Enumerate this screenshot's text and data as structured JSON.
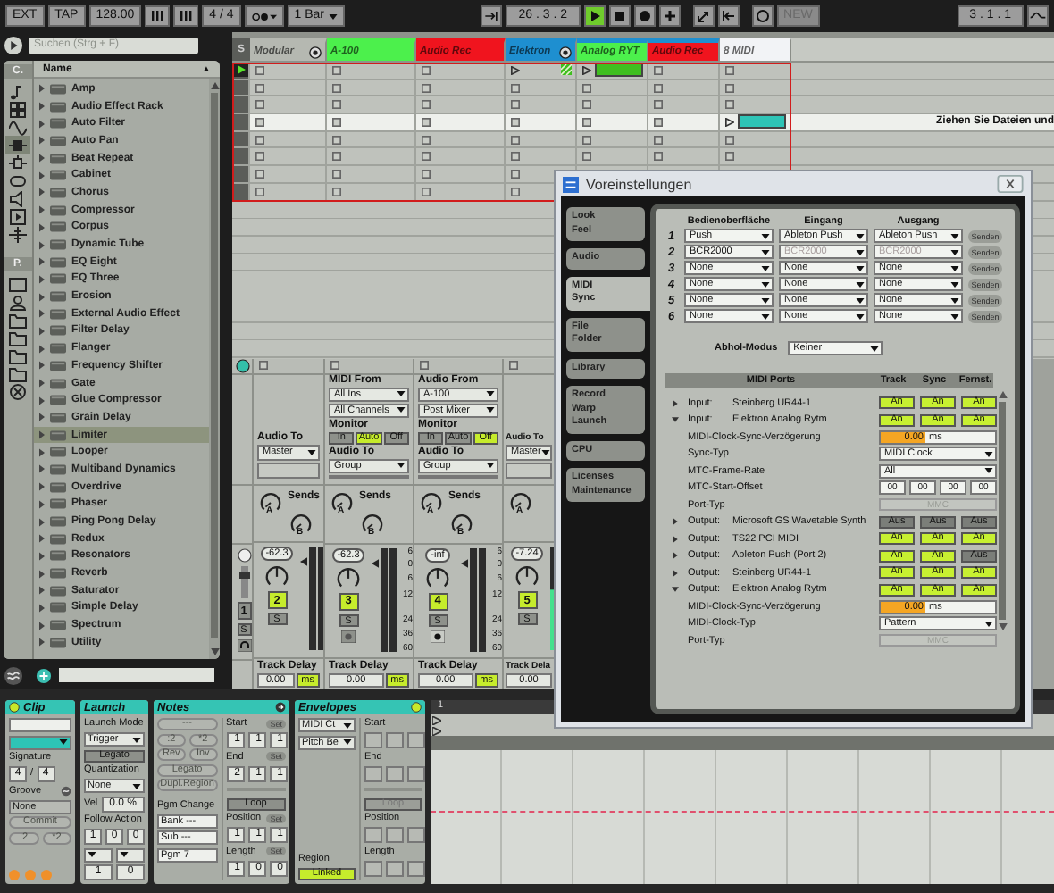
{
  "transport": {
    "left": [
      {
        "kind": "button",
        "text": "EXT"
      },
      {
        "kind": "button",
        "text": "TAP"
      },
      {
        "kind": "field",
        "text": "128.00"
      },
      {
        "kind": "nudge"
      },
      {
        "kind": "nudge"
      },
      {
        "kind": "field",
        "text": "4 / 4"
      },
      {
        "kind": "metronome"
      },
      {
        "kind": "dropdown",
        "text": "1 Bar"
      }
    ],
    "position": "26 . 3 . 2",
    "playing": true,
    "new_button": "NEW",
    "loop_position": "3 . 1 . 1"
  },
  "browser": {
    "search_placeholder": "Suchen (Strg + F)",
    "categories_label": "C.",
    "places_label": "P.",
    "column": "Name",
    "sort_mark": "▲",
    "categories": [
      {
        "selected": false
      },
      {
        "selected": false
      },
      {
        "selected": false
      },
      {
        "selected": true
      },
      {
        "selected": false
      },
      {
        "selected": false
      },
      {
        "selected": false
      },
      {
        "selected": false
      },
      {
        "selected": false
      }
    ],
    "items": [
      {
        "name": "Amp",
        "selected": false
      },
      {
        "name": "Audio Effect Rack",
        "selected": false
      },
      {
        "name": "Auto Filter",
        "selected": false
      },
      {
        "name": "Auto Pan",
        "selected": false
      },
      {
        "name": "Beat Repeat",
        "selected": false
      },
      {
        "name": "Cabinet",
        "selected": false
      },
      {
        "name": "Chorus",
        "selected": false
      },
      {
        "name": "Compressor",
        "selected": false
      },
      {
        "name": "Corpus",
        "selected": false
      },
      {
        "name": "Dynamic Tube",
        "selected": false
      },
      {
        "name": "EQ Eight",
        "selected": false
      },
      {
        "name": "EQ Three",
        "selected": false
      },
      {
        "name": "Erosion",
        "selected": false
      },
      {
        "name": "External Audio Effect",
        "selected": false
      },
      {
        "name": "Filter Delay",
        "selected": false
      },
      {
        "name": "Flanger",
        "selected": false
      },
      {
        "name": "Frequency Shifter",
        "selected": false
      },
      {
        "name": "Gate",
        "selected": false
      },
      {
        "name": "Glue Compressor",
        "selected": false
      },
      {
        "name": "Grain Delay",
        "selected": false
      },
      {
        "name": "Limiter",
        "selected": true
      },
      {
        "name": "Looper",
        "selected": false
      },
      {
        "name": "Multiband Dynamics",
        "selected": false
      },
      {
        "name": "Overdrive",
        "selected": false
      },
      {
        "name": "Phaser",
        "selected": false
      },
      {
        "name": "Ping Pong Delay",
        "selected": false
      },
      {
        "name": "Redux",
        "selected": false
      },
      {
        "name": "Resonators",
        "selected": false
      },
      {
        "name": "Reverb",
        "selected": false
      },
      {
        "name": "Saturator",
        "selected": false
      },
      {
        "name": "Simple Delay",
        "selected": false
      },
      {
        "name": "Spectrum",
        "selected": false
      },
      {
        "name": "Utility",
        "selected": false
      }
    ]
  },
  "session": {
    "solo_label": "S",
    "tracks": [
      {
        "name": "Modular",
        "color": "#b5b8b1",
        "group": true,
        "in_group": false
      },
      {
        "name": "A-100",
        "color": "#4cf04c",
        "group": false,
        "in_group": false
      },
      {
        "name": "Audio Rec",
        "color": "#f0141e",
        "group": false,
        "in_group": false
      },
      {
        "name": "Elektron",
        "color": "#1e8fd0",
        "group": true,
        "in_group": false
      },
      {
        "name": "Analog RYT",
        "color": "#4cf04c",
        "group": false,
        "in_group": true
      },
      {
        "name": "Audio Rec",
        "color": "#f0141e",
        "group": false,
        "in_group": true
      },
      {
        "name": "8 MIDI",
        "color": "#f2f3f6",
        "group": false,
        "in_group": false
      }
    ],
    "rows": [
      {
        "scene_play": true,
        "selected": false,
        "slots": [
          {
            "kind": "empty"
          },
          {
            "kind": "empty"
          },
          {
            "kind": "empty"
          },
          {
            "kind": "group-play",
            "color": "#3fbf1f"
          },
          {
            "kind": "clip",
            "color": "#3fbf1f"
          },
          {
            "kind": "empty"
          },
          {
            "kind": "empty"
          }
        ]
      },
      {
        "scene_play": false,
        "selected": false,
        "slots": [
          {
            "kind": "empty"
          },
          {
            "kind": "empty"
          },
          {
            "kind": "empty"
          },
          {
            "kind": "empty"
          },
          {
            "kind": "empty"
          },
          {
            "kind": "empty"
          },
          {
            "kind": "empty"
          }
        ]
      },
      {
        "scene_play": false,
        "selected": false,
        "slots": [
          {
            "kind": "empty"
          },
          {
            "kind": "empty"
          },
          {
            "kind": "empty"
          },
          {
            "kind": "empty"
          },
          {
            "kind": "empty"
          },
          {
            "kind": "empty"
          },
          {
            "kind": "empty"
          }
        ]
      },
      {
        "scene_play": false,
        "selected": true,
        "slots": [
          {
            "kind": "empty"
          },
          {
            "kind": "empty"
          },
          {
            "kind": "empty"
          },
          {
            "kind": "empty"
          },
          {
            "kind": "empty"
          },
          {
            "kind": "empty"
          },
          {
            "kind": "clip",
            "color": "#2ec4b6"
          }
        ],
        "hint": "Ziehen Sie Dateien und"
      },
      {
        "scene_play": false,
        "selected": false,
        "slots": [
          {
            "kind": "empty"
          },
          {
            "kind": "empty"
          },
          {
            "kind": "empty"
          },
          {
            "kind": "empty"
          },
          {
            "kind": "empty"
          },
          {
            "kind": "empty"
          },
          {
            "kind": "empty"
          }
        ]
      },
      {
        "scene_play": false,
        "selected": false,
        "slots": [
          {
            "kind": "empty"
          },
          {
            "kind": "empty"
          },
          {
            "kind": "empty"
          },
          {
            "kind": "empty"
          },
          {
            "kind": "empty"
          },
          {
            "kind": "empty"
          },
          {
            "kind": "empty"
          }
        ]
      },
      {
        "scene_play": false,
        "selected": false,
        "slots": [
          {
            "kind": "empty"
          },
          {
            "kind": "empty"
          },
          {
            "kind": "empty"
          },
          {
            "kind": "empty"
          }
        ]
      },
      {
        "scene_play": false,
        "selected": false,
        "slots": [
          {
            "kind": "empty"
          },
          {
            "kind": "empty"
          },
          {
            "kind": "empty"
          },
          {
            "kind": "empty"
          }
        ]
      }
    ]
  },
  "mixer": {
    "columns": [
      {
        "kind": "narrow",
        "number": "1",
        "solo": "S",
        "slider": {
          "level": 0.8
        }
      },
      {
        "kind": "track",
        "audio_to_label": "Audio To",
        "audio_to": "Master",
        "sends_label": "Sends",
        "sends": [
          "A",
          "B"
        ],
        "volume": "-62.3",
        "number": "2",
        "solo": "S",
        "delay_label": "Track Delay",
        "delay": "0.00",
        "delay_unit": "ms"
      },
      {
        "kind": "track",
        "from_label": "MIDI From",
        "from": "All Ins",
        "channel": "All Channels",
        "monitor_label": "Monitor",
        "monitor": [
          {
            "text": "In",
            "selected": false
          },
          {
            "text": "Auto",
            "selected": true
          },
          {
            "text": "Off",
            "selected": false
          }
        ],
        "audio_to_label": "Audio To",
        "audio_to": "Group",
        "sends_label": "Sends",
        "sends": [
          "A",
          "B"
        ],
        "volume": "-62.3",
        "number": "3",
        "solo": "S",
        "arm": false,
        "meter_scale": [
          "6",
          "0",
          "6",
          "12",
          "24",
          "36",
          "60"
        ],
        "delay_label": "Track Delay",
        "delay": "0.00",
        "delay_unit": "ms"
      },
      {
        "kind": "track",
        "from_label": "Audio From",
        "from": "A-100",
        "channel": "Post Mixer",
        "monitor_label": "Monitor",
        "monitor": [
          {
            "text": "In",
            "selected": false
          },
          {
            "text": "Auto",
            "selected": false
          },
          {
            "text": "Off",
            "selected": true
          }
        ],
        "audio_to_label": "Audio To",
        "audio_to": "Group",
        "sends_label": "Sends",
        "sends": [
          "A",
          "B"
        ],
        "volume": "-inf",
        "number": "4",
        "solo": "S",
        "arm": true,
        "meter_scale": [
          "6",
          "0",
          "6",
          "12",
          "24",
          "36",
          "60"
        ],
        "delay_label": "Track Delay",
        "delay": "0.00",
        "delay_unit": "ms"
      },
      {
        "kind": "partial",
        "audio_to_label": "Audio To",
        "audio_to": "Master",
        "sends": [
          "A"
        ],
        "volume": "-7.24",
        "number": "5",
        "solo": "S",
        "delay_label": "Track Dela",
        "delay": "0.00"
      }
    ]
  },
  "preferences": {
    "title": "Voreinstellungen",
    "tabs": [
      {
        "lines": [
          "Look",
          "Feel"
        ],
        "selected": false
      },
      {
        "lines": [
          "Audio"
        ],
        "selected": false
      },
      {
        "lines": [
          "MIDI",
          "Sync"
        ],
        "selected": true
      },
      {
        "lines": [
          "File",
          "Folder"
        ],
        "selected": false
      },
      {
        "lines": [
          "Library"
        ],
        "selected": false
      },
      {
        "lines": [
          "Record",
          "Warp",
          "Launch"
        ],
        "selected": false
      },
      {
        "lines": [
          "CPU"
        ],
        "selected": false
      },
      {
        "lines": [
          "Licenses",
          "Maintenance"
        ],
        "selected": false
      }
    ],
    "surface_headers": [
      "Bedienoberfläche",
      "Eingang",
      "Ausgang"
    ],
    "surfaces": [
      {
        "number": "1",
        "surface": "Push",
        "input": "Ableton Push",
        "output": "Ableton Push",
        "dump": "Senden",
        "io_disabled": false
      },
      {
        "number": "2",
        "surface": "BCR2000",
        "input": "BCR2000",
        "output": "BCR2000",
        "dump": "Senden",
        "io_disabled": true
      },
      {
        "number": "3",
        "surface": "None",
        "input": "None",
        "output": "None",
        "dump": "Senden",
        "io_disabled": false
      },
      {
        "number": "4",
        "surface": "None",
        "input": "None",
        "output": "None",
        "dump": "Senden",
        "io_disabled": false
      },
      {
        "number": "5",
        "surface": "None",
        "input": "None",
        "output": "None",
        "dump": "Senden",
        "io_disabled": false
      },
      {
        "number": "6",
        "surface": "None",
        "input": "None",
        "output": "None",
        "dump": "Senden",
        "io_disabled": false
      }
    ],
    "takeover_label": "Abhol-Modus",
    "takeover": "Keiner",
    "ports_headers": [
      "MIDI Ports",
      "Track",
      "Sync",
      "Fernst."
    ],
    "ports": [
      {
        "kind": "port",
        "direction": "Input:",
        "name": "Steinberg UR44-1",
        "expanded": false,
        "toggles": [
          {
            "text": "An",
            "on": true
          },
          {
            "text": "An",
            "on": true
          },
          {
            "text": "An",
            "on": true
          }
        ]
      },
      {
        "kind": "port",
        "direction": "Input:",
        "name": "Elektron Analog Rytm",
        "expanded": true,
        "toggles": [
          {
            "text": "An",
            "on": true
          },
          {
            "text": "An",
            "on": true
          },
          {
            "text": "An",
            "on": true
          }
        ]
      },
      {
        "kind": "number",
        "label": "MIDI-Clock-Sync-Verzögerung",
        "value": "0.00",
        "unit": "ms"
      },
      {
        "kind": "dropdown",
        "label": "Sync-Typ",
        "value": "MIDI Clock"
      },
      {
        "kind": "dropdown",
        "label": "MTC-Frame-Rate",
        "value": "All"
      },
      {
        "kind": "timecode",
        "label": "MTC-Start-Offset",
        "parts": [
          "00",
          "00",
          "00",
          "00"
        ]
      },
      {
        "kind": "disabled",
        "label": "Port-Typ",
        "value": "MMC"
      },
      {
        "kind": "port",
        "direction": "Output:",
        "name": "Microsoft GS Wavetable Synth",
        "expanded": false,
        "toggles": [
          {
            "text": "Aus",
            "on": false
          },
          {
            "text": "Aus",
            "on": false
          },
          {
            "text": "Aus",
            "on": false
          }
        ]
      },
      {
        "kind": "port",
        "direction": "Output:",
        "name": "TS22 PCI MIDI",
        "expanded": false,
        "toggles": [
          {
            "text": "An",
            "on": true
          },
          {
            "text": "An",
            "on": true
          },
          {
            "text": "An",
            "on": true
          }
        ]
      },
      {
        "kind": "port",
        "direction": "Output:",
        "name": "Ableton Push (Port 2)",
        "expanded": false,
        "toggles": [
          {
            "text": "An",
            "on": true
          },
          {
            "text": "An",
            "on": true
          },
          {
            "text": "Aus",
            "on": false
          }
        ]
      },
      {
        "kind": "port",
        "direction": "Output:",
        "name": "Steinberg UR44-1",
        "expanded": false,
        "toggles": [
          {
            "text": "An",
            "on": true
          },
          {
            "text": "An",
            "on": true
          },
          {
            "text": "An",
            "on": true
          }
        ]
      },
      {
        "kind": "port",
        "direction": "Output:",
        "name": "Elektron Analog Rytm",
        "expanded": true,
        "toggles": [
          {
            "text": "An",
            "on": true
          },
          {
            "text": "An",
            "on": true
          },
          {
            "text": "An",
            "on": true
          }
        ]
      },
      {
        "kind": "number",
        "label": "MIDI-Clock-Sync-Verzögerung",
        "value": "0.00",
        "unit": "ms"
      },
      {
        "kind": "dropdown",
        "label": "MIDI-Clock-Typ",
        "value": "Pattern"
      },
      {
        "kind": "disabled",
        "label": "Port-Typ",
        "value": "MMC"
      }
    ]
  },
  "detail": {
    "clip": {
      "title": "Clip",
      "signature_label": "Signature",
      "sig_num": "4",
      "sig_sep": "/",
      "sig_den": "4",
      "groove_label": "Groove",
      "groove": "None",
      "commit": "Commit",
      "halve": ":2",
      "double": "*2"
    },
    "launch": {
      "title": "Launch",
      "mode_label": "Launch Mode",
      "mode": "Trigger",
      "legato": "Legato",
      "quant_label": "Quantization",
      "quant": "None",
      "vel_label": "Vel",
      "vel": "0.0 %",
      "follow_label": "Follow Action",
      "follow_time": [
        "1",
        "0",
        "0"
      ],
      "chances": [
        "1",
        "0"
      ]
    },
    "notes": {
      "title": "Notes",
      "range": "---",
      "buttons": [
        ":2",
        "*2",
        "Rev",
        "Inv"
      ],
      "legato": "Legato",
      "dupl": "Dupl.Region",
      "pgm_label": "Pgm Change",
      "bank": "Bank ---",
      "sub": "Sub ---",
      "pgm": "Pgm 7",
      "markers": [
        {
          "label": "Start",
          "set": "Set",
          "values": [
            "1",
            "1",
            "1"
          ]
        },
        {
          "label": "End",
          "set": "Set",
          "values": [
            "2",
            "1",
            "1"
          ]
        }
      ],
      "loop": "Loop",
      "loop_markers": [
        {
          "label": "Position",
          "set": "Set",
          "values": [
            "1",
            "1",
            "1"
          ]
        },
        {
          "label": "Length",
          "set": "Set",
          "values": [
            "1",
            "0",
            "0"
          ]
        }
      ]
    },
    "envelopes": {
      "title": "Envelopes",
      "device": "MIDI Ct",
      "control": "Pitch Be",
      "region_label": "Region",
      "region": "Linked",
      "markers": [
        "Start",
        "End"
      ],
      "loop": "Loop",
      "loop_markers": [
        "Position",
        "Length"
      ]
    },
    "arrangement": {
      "ruler_mark": "1"
    }
  }
}
